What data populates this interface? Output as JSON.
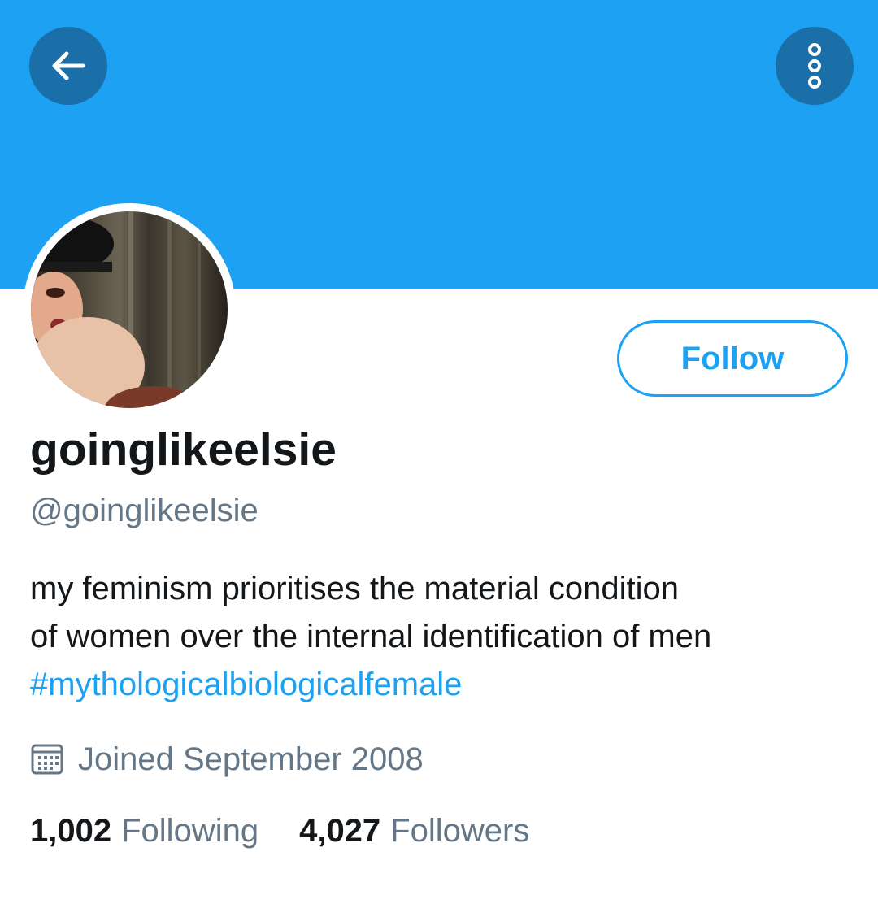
{
  "colors": {
    "banner": "#1da1f2",
    "accent": "#1da1f2",
    "icon_button_bg": "#1a6fa8",
    "secondary_text": "#657786",
    "primary_text": "#14171a"
  },
  "header": {
    "back_icon": "arrow-left-icon",
    "more_icon": "vertical-dots-icon"
  },
  "profile": {
    "display_name": "goinglikeelsie",
    "handle": "@goinglikeelsie",
    "follow_label": "Follow",
    "bio": {
      "line1": "my feminism prioritises the material condition",
      "line2": "of women over the internal identification of men",
      "hashtag": "#mythologicalbiologicalfemale"
    },
    "joined": {
      "icon": "calendar-icon",
      "text": "Joined September 2008"
    },
    "stats": {
      "following_count": "1,002",
      "following_label": "Following",
      "followers_count": "4,027",
      "followers_label": "Followers"
    }
  }
}
